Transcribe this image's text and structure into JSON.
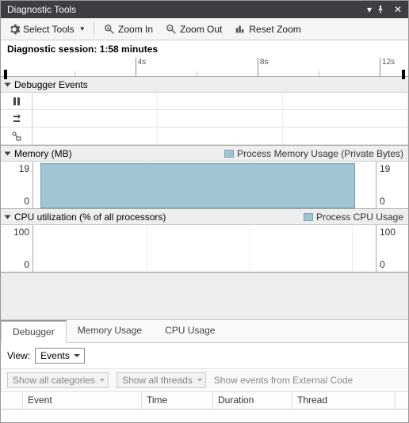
{
  "window": {
    "title": "Diagnostic Tools"
  },
  "toolbar": {
    "select_tools": "Select Tools",
    "zoom_in": "Zoom In",
    "zoom_out": "Zoom Out",
    "reset_zoom": "Reset Zoom"
  },
  "session": {
    "label": "Diagnostic session: 1:58 minutes"
  },
  "ruler": {
    "ticks": [
      "4s",
      "8s",
      "12s"
    ]
  },
  "sections": {
    "debugger_events": {
      "title": "Debugger Events"
    },
    "memory": {
      "title": "Memory (MB)",
      "legend": "Process Memory Usage (Private Bytes)",
      "max": "19",
      "min": "0",
      "legend_color": "#a1c5d3"
    },
    "cpu": {
      "title": "CPU utilization (% of all processors)",
      "legend": "Process CPU Usage",
      "max": "100",
      "min": "0",
      "legend_color": "#a1c5d3"
    }
  },
  "tabs": {
    "debugger": "Debugger",
    "memory": "Memory Usage",
    "cpu": "CPU Usage"
  },
  "view": {
    "label": "View:",
    "value": "Events"
  },
  "filters": {
    "categories": "Show all categories",
    "threads": "Show all threads",
    "hint": "Show events from External Code"
  },
  "grid": {
    "col_event": "Event",
    "col_time": "Time",
    "col_duration": "Duration",
    "col_thread": "Thread"
  },
  "chart_data": [
    {
      "type": "area",
      "title": "Memory (MB)",
      "ylabel": "MB",
      "ylim": [
        0,
        19
      ],
      "xlim_seconds": [
        0,
        13
      ],
      "series": [
        {
          "name": "Process Memory Usage (Private Bytes)",
          "x": [
            0,
            2,
            4,
            6,
            8,
            10,
            12,
            13
          ],
          "values": [
            19,
            19,
            19,
            19,
            19,
            19,
            19,
            19
          ]
        }
      ]
    },
    {
      "type": "area",
      "title": "CPU utilization (% of all processors)",
      "ylabel": "%",
      "ylim": [
        0,
        100
      ],
      "xlim_seconds": [
        0,
        13
      ],
      "series": [
        {
          "name": "Process CPU Usage",
          "x": [
            0,
            2,
            4,
            6,
            8,
            10,
            12,
            13
          ],
          "values": [
            0,
            0,
            0,
            0,
            0,
            0,
            0,
            0
          ]
        }
      ]
    }
  ]
}
